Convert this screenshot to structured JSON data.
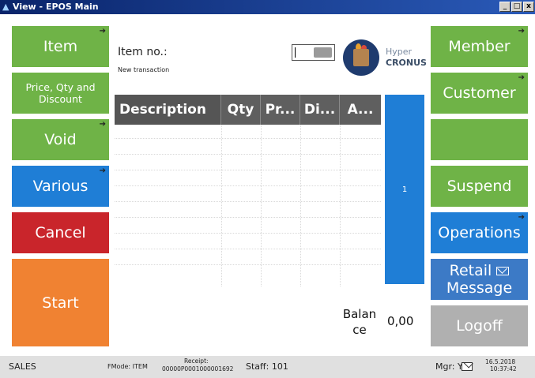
{
  "window": {
    "title": "View - EPOS Main"
  },
  "window_controls": {
    "minimize": "_",
    "maximize": "□",
    "close": "x"
  },
  "left_buttons": {
    "item": {
      "label": "Item",
      "arrow": "➔"
    },
    "price_qty_discount": {
      "label_line1": "Price, Qty and",
      "label_line2": "Discount"
    },
    "void": {
      "label": "Void",
      "arrow": "➔"
    },
    "various": {
      "label": "Various",
      "arrow": "➔"
    },
    "cancel": {
      "label": "Cancel"
    },
    "start": {
      "label": "Start"
    }
  },
  "right_buttons": {
    "member": {
      "label": "Member",
      "arrow": "➔"
    },
    "customer": {
      "label": "Customer",
      "arrow": "➔"
    },
    "blank": {
      "label": ""
    },
    "suspend": {
      "label": "Suspend"
    },
    "operations": {
      "label": "Operations",
      "arrow": "➔"
    },
    "retail_message": {
      "label_line1": "Retail",
      "label_line2": "Message"
    },
    "logoff": {
      "label": "Logoff"
    }
  },
  "center": {
    "item_no_label": "Item no.:",
    "transaction_status": "New transaction",
    "item_no_value": "",
    "brand_line1": "Hyper",
    "brand_line2": "CRONUS",
    "columns": [
      "Description",
      "Qty",
      "Pr...",
      "Di...",
      "A..."
    ],
    "rows": [],
    "page_indicator": "1",
    "balance_label_line1": "Balan",
    "balance_label_line2": "ce",
    "balance_value": "0,00"
  },
  "status_bar": {
    "mode": "SALES",
    "fmode": "FMode: ITEM",
    "receipt_label": "Receipt:",
    "receipt_value": "00000P0001000001692",
    "staff": "Staff: 101",
    "manager": "Mgr: Y",
    "date": "16.5.2018",
    "time": "10:37:42"
  },
  "colors": {
    "green": "#6fb347",
    "blue": "#1f7ed6",
    "red": "#c9252b",
    "orange": "#f08232",
    "gray": "#b0b0b0",
    "header": "#5f5f5f"
  }
}
